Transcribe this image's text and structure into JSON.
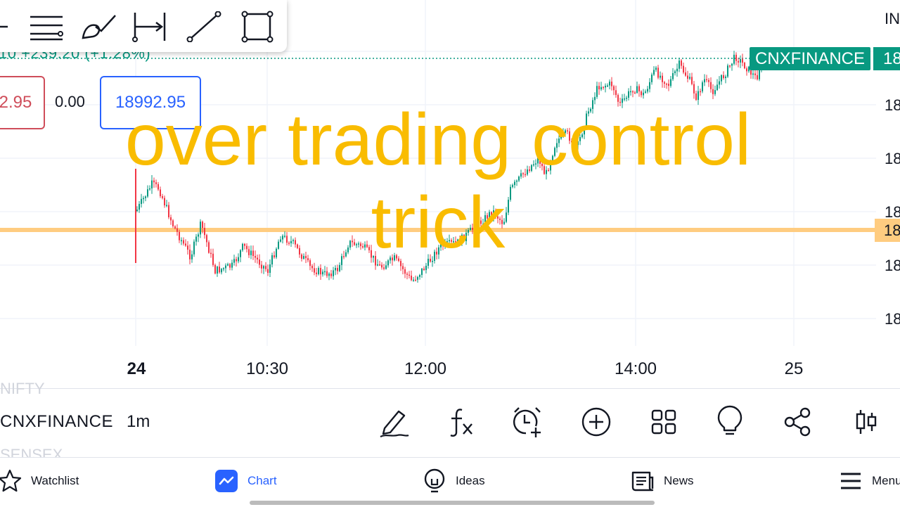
{
  "drawing_toolbar": {
    "tools": [
      {
        "name": "trend-angle-icon"
      },
      {
        "name": "fib-retracement-icon"
      },
      {
        "name": "brush-icon"
      },
      {
        "name": "date-range-icon"
      },
      {
        "name": "trend-line-icon"
      },
      {
        "name": "rectangle-icon"
      }
    ]
  },
  "chart": {
    "change_text": "10 +239.20 (+1.28%)",
    "sell_price": "2.95",
    "spread": "0.00",
    "buy_price": "18992.95",
    "symbol_tag": "CNXFINANCE",
    "last_price_tag": "18",
    "hline_price_tag": "18",
    "top_right_label": "IN",
    "y_ticks": [
      "18",
      "18",
      "18",
      "18",
      "18"
    ],
    "x_ticks": [
      "24",
      "10:30",
      "12:00",
      "14:00",
      "25"
    ],
    "overlay_line1": "over trading control",
    "overlay_line2": "trick",
    "colors": {
      "up": "#089981",
      "down": "#f23645",
      "hline": "#ffcc80",
      "overlay": "#f9bc00"
    }
  },
  "symbol_bar": {
    "ghost_top": "NIFTY",
    "symbol": "CNXFINANCE",
    "timeframe": "1m",
    "ghost_bottom": "SENSEX",
    "actions": [
      {
        "name": "draw-pencil-icon"
      },
      {
        "name": "indicators-fx-icon"
      },
      {
        "name": "add-alert-icon"
      },
      {
        "name": "add-icon"
      },
      {
        "name": "layouts-grid-icon"
      },
      {
        "name": "ideas-bulb-icon"
      },
      {
        "name": "share-icon"
      },
      {
        "name": "chart-type-candles-icon"
      }
    ]
  },
  "bottom_nav": {
    "items": [
      {
        "label": "Watchlist",
        "icon": "star-icon"
      },
      {
        "label": "Chart",
        "icon": "chart-icon",
        "active": true
      },
      {
        "label": "Ideas",
        "icon": "lightbulb-icon"
      },
      {
        "label": "News",
        "icon": "news-icon"
      },
      {
        "label": "Menu",
        "icon": "menu-icon"
      }
    ]
  }
}
